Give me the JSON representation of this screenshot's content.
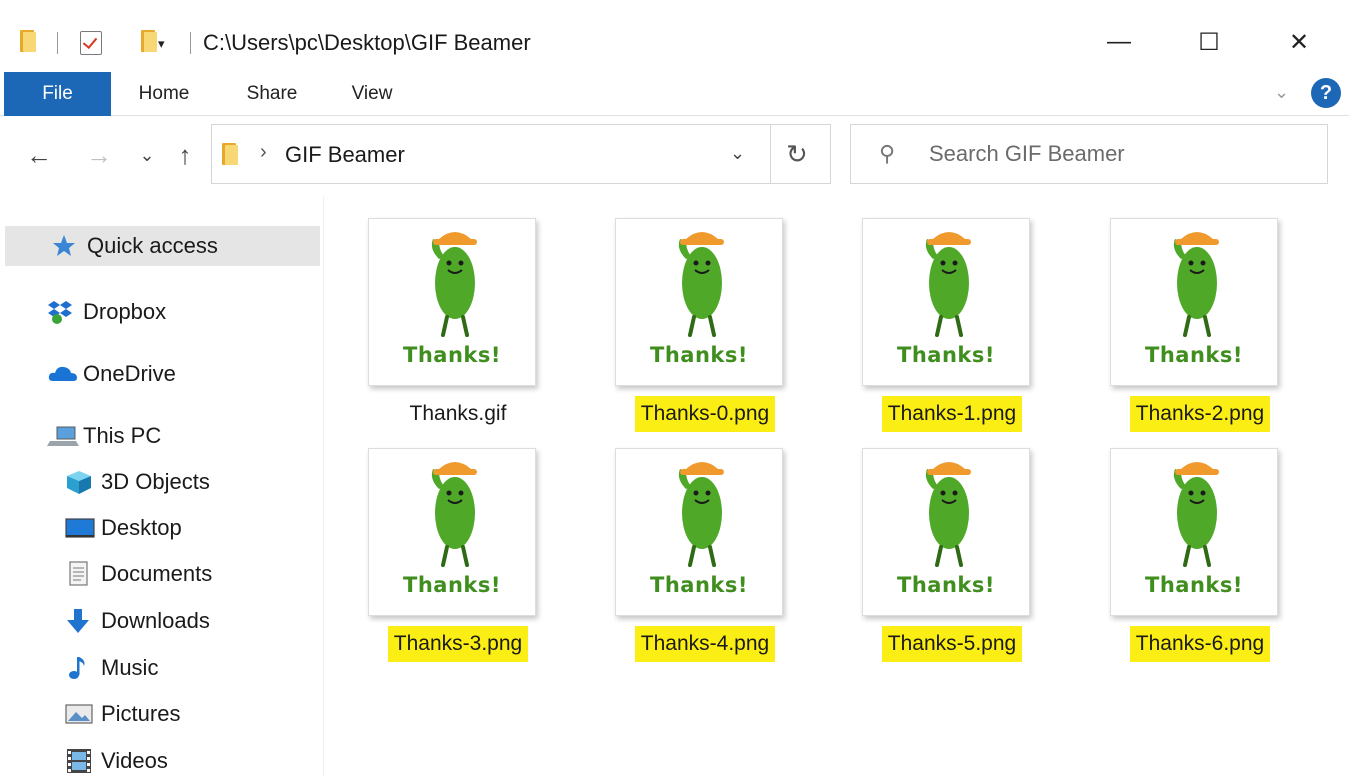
{
  "window": {
    "title_path": "C:\\Users\\pc\\Desktop\\GIF Beamer",
    "controls": {
      "minimize": "—",
      "maximize": "☐",
      "close": "✕"
    }
  },
  "quick_access_toolbar": {
    "dropdown": "▾"
  },
  "ribbon": {
    "tabs": [
      {
        "label": "File",
        "active": true
      },
      {
        "label": "Home"
      },
      {
        "label": "Share"
      },
      {
        "label": "View"
      }
    ],
    "expand": "⌄",
    "help": "?"
  },
  "nav": {
    "back": "←",
    "forward": "→",
    "recent": "⌄",
    "up": "↑",
    "breadcrumb_sep": "›",
    "breadcrumb": "GIF Beamer",
    "address_dropdown": "⌄",
    "refresh": "↻"
  },
  "search": {
    "placeholder": "Search GIF Beamer",
    "value": ""
  },
  "sidebar": {
    "items": [
      {
        "label": "Quick access",
        "icon": "star-icon",
        "selected": true
      },
      {
        "label": "Dropbox",
        "icon": "dropbox-icon"
      },
      {
        "label": "OneDrive",
        "icon": "cloud-icon"
      },
      {
        "label": "This PC",
        "icon": "computer-icon"
      },
      {
        "label": "3D Objects",
        "icon": "cube-icon"
      },
      {
        "label": "Desktop",
        "icon": "desktop-icon"
      },
      {
        "label": "Documents",
        "icon": "document-icon"
      },
      {
        "label": "Downloads",
        "icon": "download-icon"
      },
      {
        "label": "Music",
        "icon": "music-icon"
      },
      {
        "label": "Pictures",
        "icon": "picture-icon"
      },
      {
        "label": "Videos",
        "icon": "video-icon"
      }
    ]
  },
  "files": [
    {
      "name": "Thanks.gif",
      "caption": "Thanks!",
      "highlighted": false
    },
    {
      "name": "Thanks-0.png",
      "caption": "Thanks!",
      "highlighted": true
    },
    {
      "name": "Thanks-1.png",
      "caption": "Thanks!",
      "highlighted": true
    },
    {
      "name": "Thanks-2.png",
      "caption": "Thanks!",
      "highlighted": true
    },
    {
      "name": "Thanks-3.png",
      "caption": "Thanks!",
      "highlighted": true
    },
    {
      "name": "Thanks-4.png",
      "caption": "Thanks!",
      "highlighted": true
    },
    {
      "name": "Thanks-5.png",
      "caption": "Thanks!",
      "highlighted": true
    },
    {
      "name": "Thanks-6.png",
      "caption": "Thanks!",
      "highlighted": true
    }
  ],
  "colors": {
    "accent": "#1c67b6",
    "highlight": "#fbee14",
    "bean_green": "#4fa828",
    "hat_orange": "#f09a2e",
    "caption_green": "#3f8e1e"
  }
}
